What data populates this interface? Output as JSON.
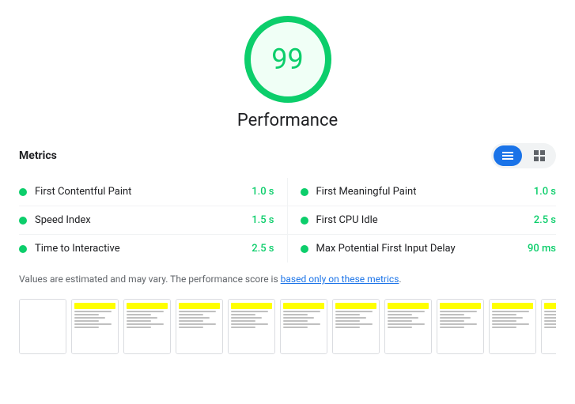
{
  "score": {
    "value": "99",
    "label": "Performance"
  },
  "metrics": {
    "title": "Metrics",
    "toggle": {
      "list_label": "list-view",
      "grid_label": "grid-view"
    },
    "left": [
      {
        "name": "First Contentful Paint",
        "value": "1.0 s"
      },
      {
        "name": "Speed Index",
        "value": "1.5 s"
      },
      {
        "name": "Time to Interactive",
        "value": "2.5 s"
      }
    ],
    "right": [
      {
        "name": "First Meaningful Paint",
        "value": "1.0 s"
      },
      {
        "name": "First CPU Idle",
        "value": "2.5 s"
      },
      {
        "name": "Max Potential First Input Delay",
        "value": "90 ms"
      }
    ],
    "note": "Values are estimated and may vary. The performance score is ",
    "note_link": "based only on these metrics",
    "note_end": "."
  }
}
